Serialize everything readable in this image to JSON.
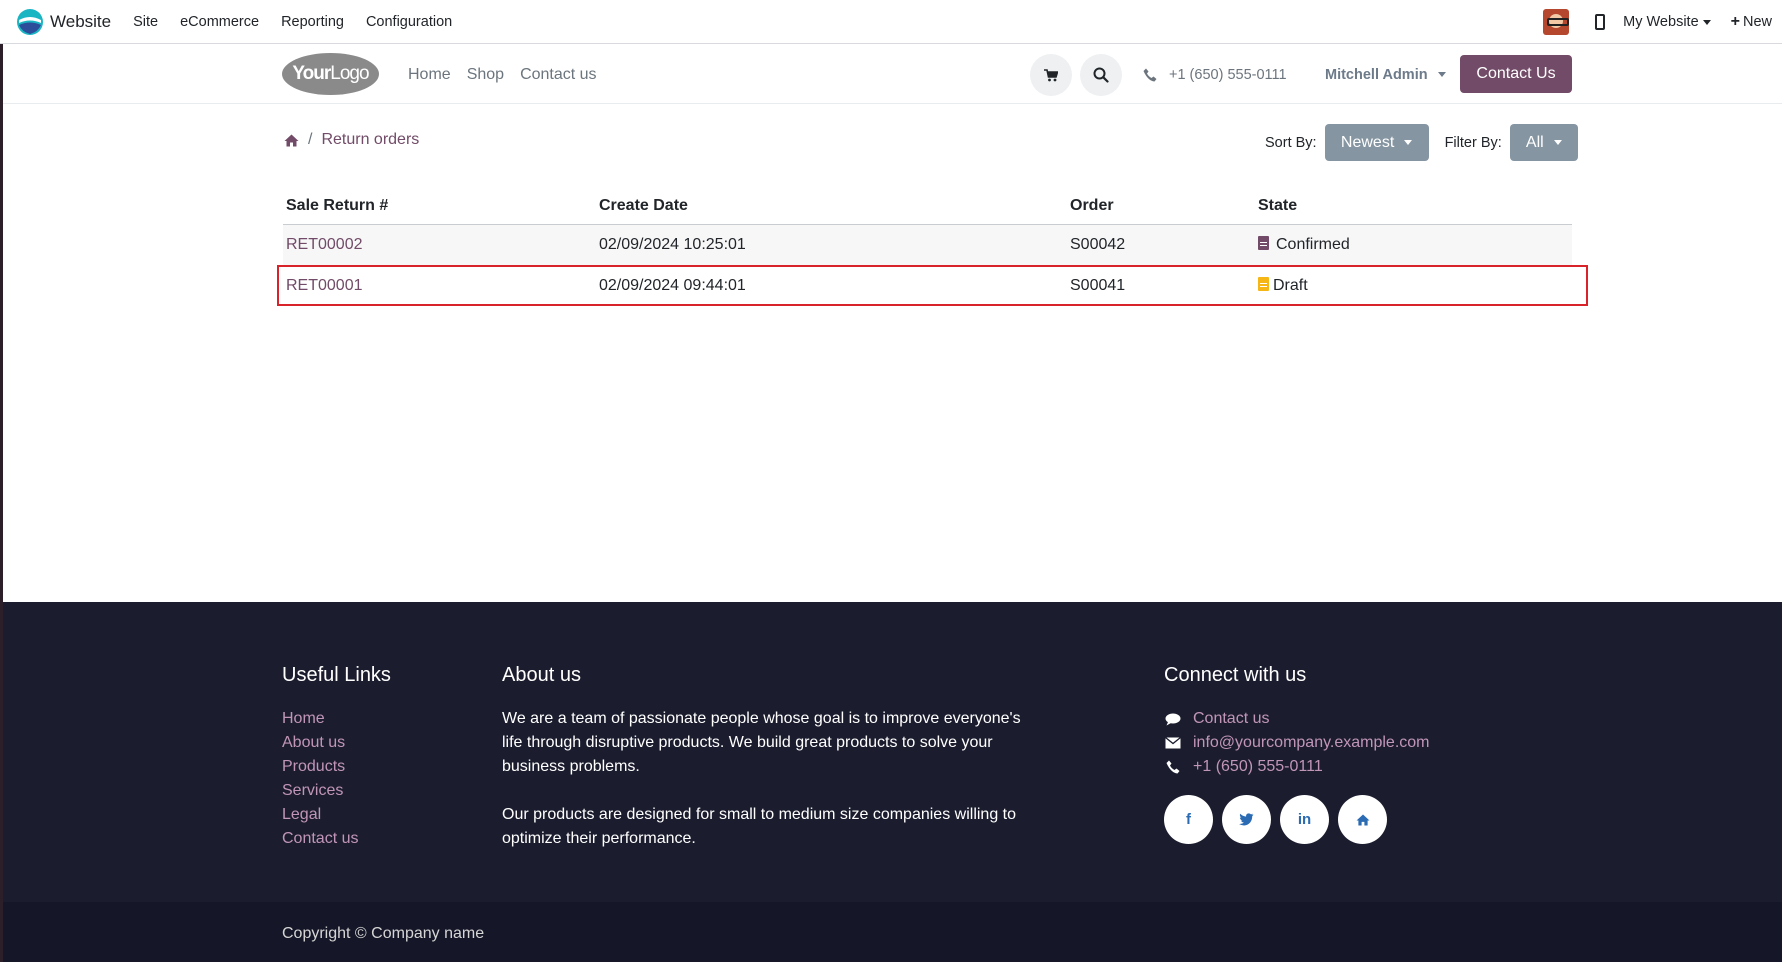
{
  "admin_bar": {
    "app_name": "Website",
    "menu": [
      "Site",
      "eCommerce",
      "Reporting",
      "Configuration"
    ],
    "website_switch": "My Website",
    "new_label": "New"
  },
  "header": {
    "logo_part1": "Your",
    "logo_part2": "Logo",
    "nav": [
      "Home",
      "Shop",
      "Contact us"
    ],
    "phone": "+1 (650) 555-0111",
    "user": "Mitchell Admin",
    "contact_button": "Contact Us"
  },
  "breadcrumb": {
    "separator": "/",
    "current": "Return orders"
  },
  "sort": {
    "label": "Sort By:",
    "value": "Newest"
  },
  "filter": {
    "label": "Filter By:",
    "value": "All"
  },
  "table": {
    "headers": [
      "Sale Return #",
      "Create Date",
      "Order",
      "State"
    ],
    "rows": [
      {
        "ref": "RET00002",
        "date": "02/09/2024 10:25:01",
        "order": "S00042",
        "state": "Confirmed"
      },
      {
        "ref": "RET00001",
        "date": "02/09/2024 09:44:01",
        "order": "S00041",
        "state": "Draft"
      }
    ]
  },
  "footer": {
    "useful_links_title": "Useful Links",
    "useful_links": [
      "Home",
      "About us",
      "Products",
      "Services",
      "Legal",
      "Contact us"
    ],
    "about_title": "About us",
    "about_p1": "We are a team of passionate people whose goal is to improve everyone's life through disruptive products. We build great products to solve your business problems.",
    "about_p2": "Our products are designed for small to medium size companies willing to optimize their performance.",
    "connect_title": "Connect with us",
    "connect_contact": "Contact us",
    "connect_email": "info@yourcompany.example.com",
    "connect_phone": "+1 (650) 555-0111",
    "socials": [
      "facebook-icon",
      "twitter-icon",
      "linkedin-icon",
      "home-icon"
    ],
    "copyright": "Copyright © Company name"
  },
  "colors": {
    "brand": "#714b67",
    "draft": "#f5b616",
    "footer_bg": "#1b1d2e",
    "highlight": "#d9232a"
  }
}
